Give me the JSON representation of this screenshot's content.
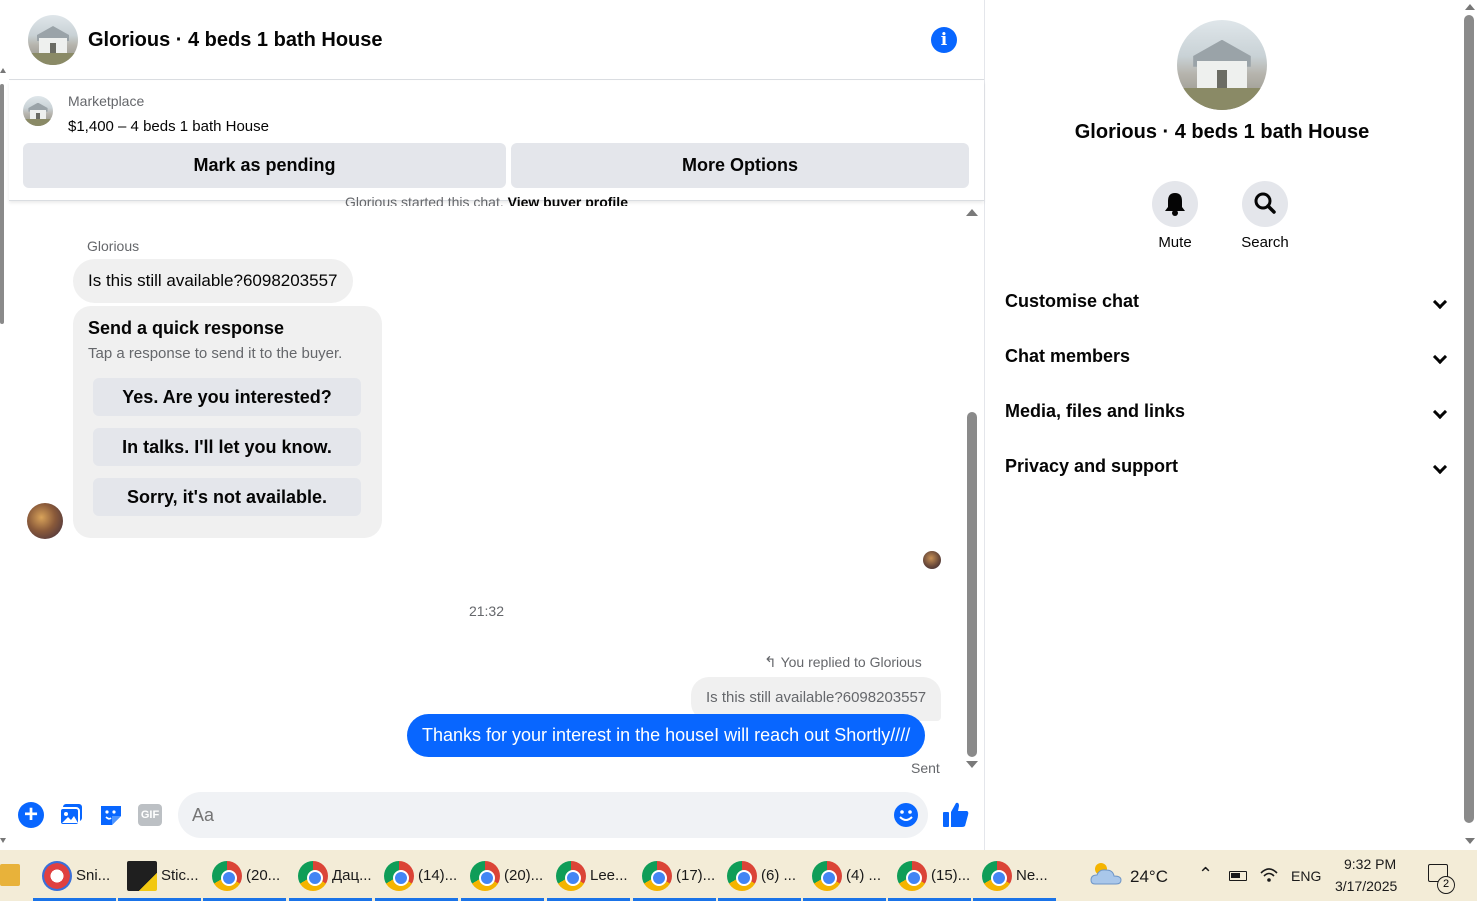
{
  "chat": {
    "title": "Glorious · 4 beds 1 bath House",
    "listing": {
      "source": "Marketplace",
      "price_line": "$1,400 – 4 beds 1 bath House",
      "primary_button": "Mark as pending",
      "secondary_button": "More Options"
    },
    "started_text": "Glorious started this chat.",
    "started_link": "View buyer profile",
    "messages": {
      "sender_name": "Glorious",
      "incoming_text": "Is this still available?6098203557",
      "quick_response": {
        "title": "Send a quick response",
        "subtitle": "Tap a response to send it to the buyer.",
        "options": [
          "Yes. Are you interested?",
          "In talks. I'll let you know.",
          "Sorry, it's not available."
        ]
      },
      "timestamp": "21:32",
      "replied_label": "You replied to Glorious",
      "quoted_text": "Is this still available?6098203557",
      "outgoing_text": "Thanks for your interest in the houseI will reach out Shortly////",
      "status": "Sent"
    },
    "composer": {
      "placeholder": "Aa",
      "icons": [
        "plus-icon",
        "photo-icon",
        "sticker-icon",
        "gif-icon",
        "emoji-icon",
        "like-icon"
      ],
      "gif_label": "GIF"
    },
    "colors": {
      "accent": "#0866ff",
      "bubble_in": "#f0f0f0",
      "button_bg": "#e4e6eb"
    }
  },
  "info_panel": {
    "title": "Glorious · 4 beds 1 bath House",
    "actions": [
      {
        "label": "Mute",
        "icon": "bell-icon"
      },
      {
        "label": "Search",
        "icon": "search-icon"
      }
    ],
    "sections": [
      "Customise chat",
      "Chat members",
      "Media, files and links",
      "Privacy and support"
    ]
  },
  "taskbar": {
    "items": [
      {
        "label": "Sni...",
        "icon": "snipping-tool-icon"
      },
      {
        "label": "Stic...",
        "icon": "sticky-notes-icon"
      },
      {
        "label": "(20...",
        "icon": "chrome-icon"
      },
      {
        "label": "Дац...",
        "icon": "chrome-icon"
      },
      {
        "label": "(14)...",
        "icon": "chrome-icon"
      },
      {
        "label": "(20)...",
        "icon": "chrome-icon"
      },
      {
        "label": "Lee...",
        "icon": "chrome-icon"
      },
      {
        "label": "(17)...",
        "icon": "chrome-icon"
      },
      {
        "label": "(6) ...",
        "icon": "chrome-icon"
      },
      {
        "label": "(4) ...",
        "icon": "chrome-icon"
      },
      {
        "label": "(15)...",
        "icon": "chrome-icon"
      },
      {
        "label": "Ne...",
        "icon": "chrome-icon"
      }
    ],
    "weather": "24°C",
    "language": "ENG",
    "time": "9:32 PM",
    "date": "3/17/2025",
    "notification_count": "2"
  }
}
